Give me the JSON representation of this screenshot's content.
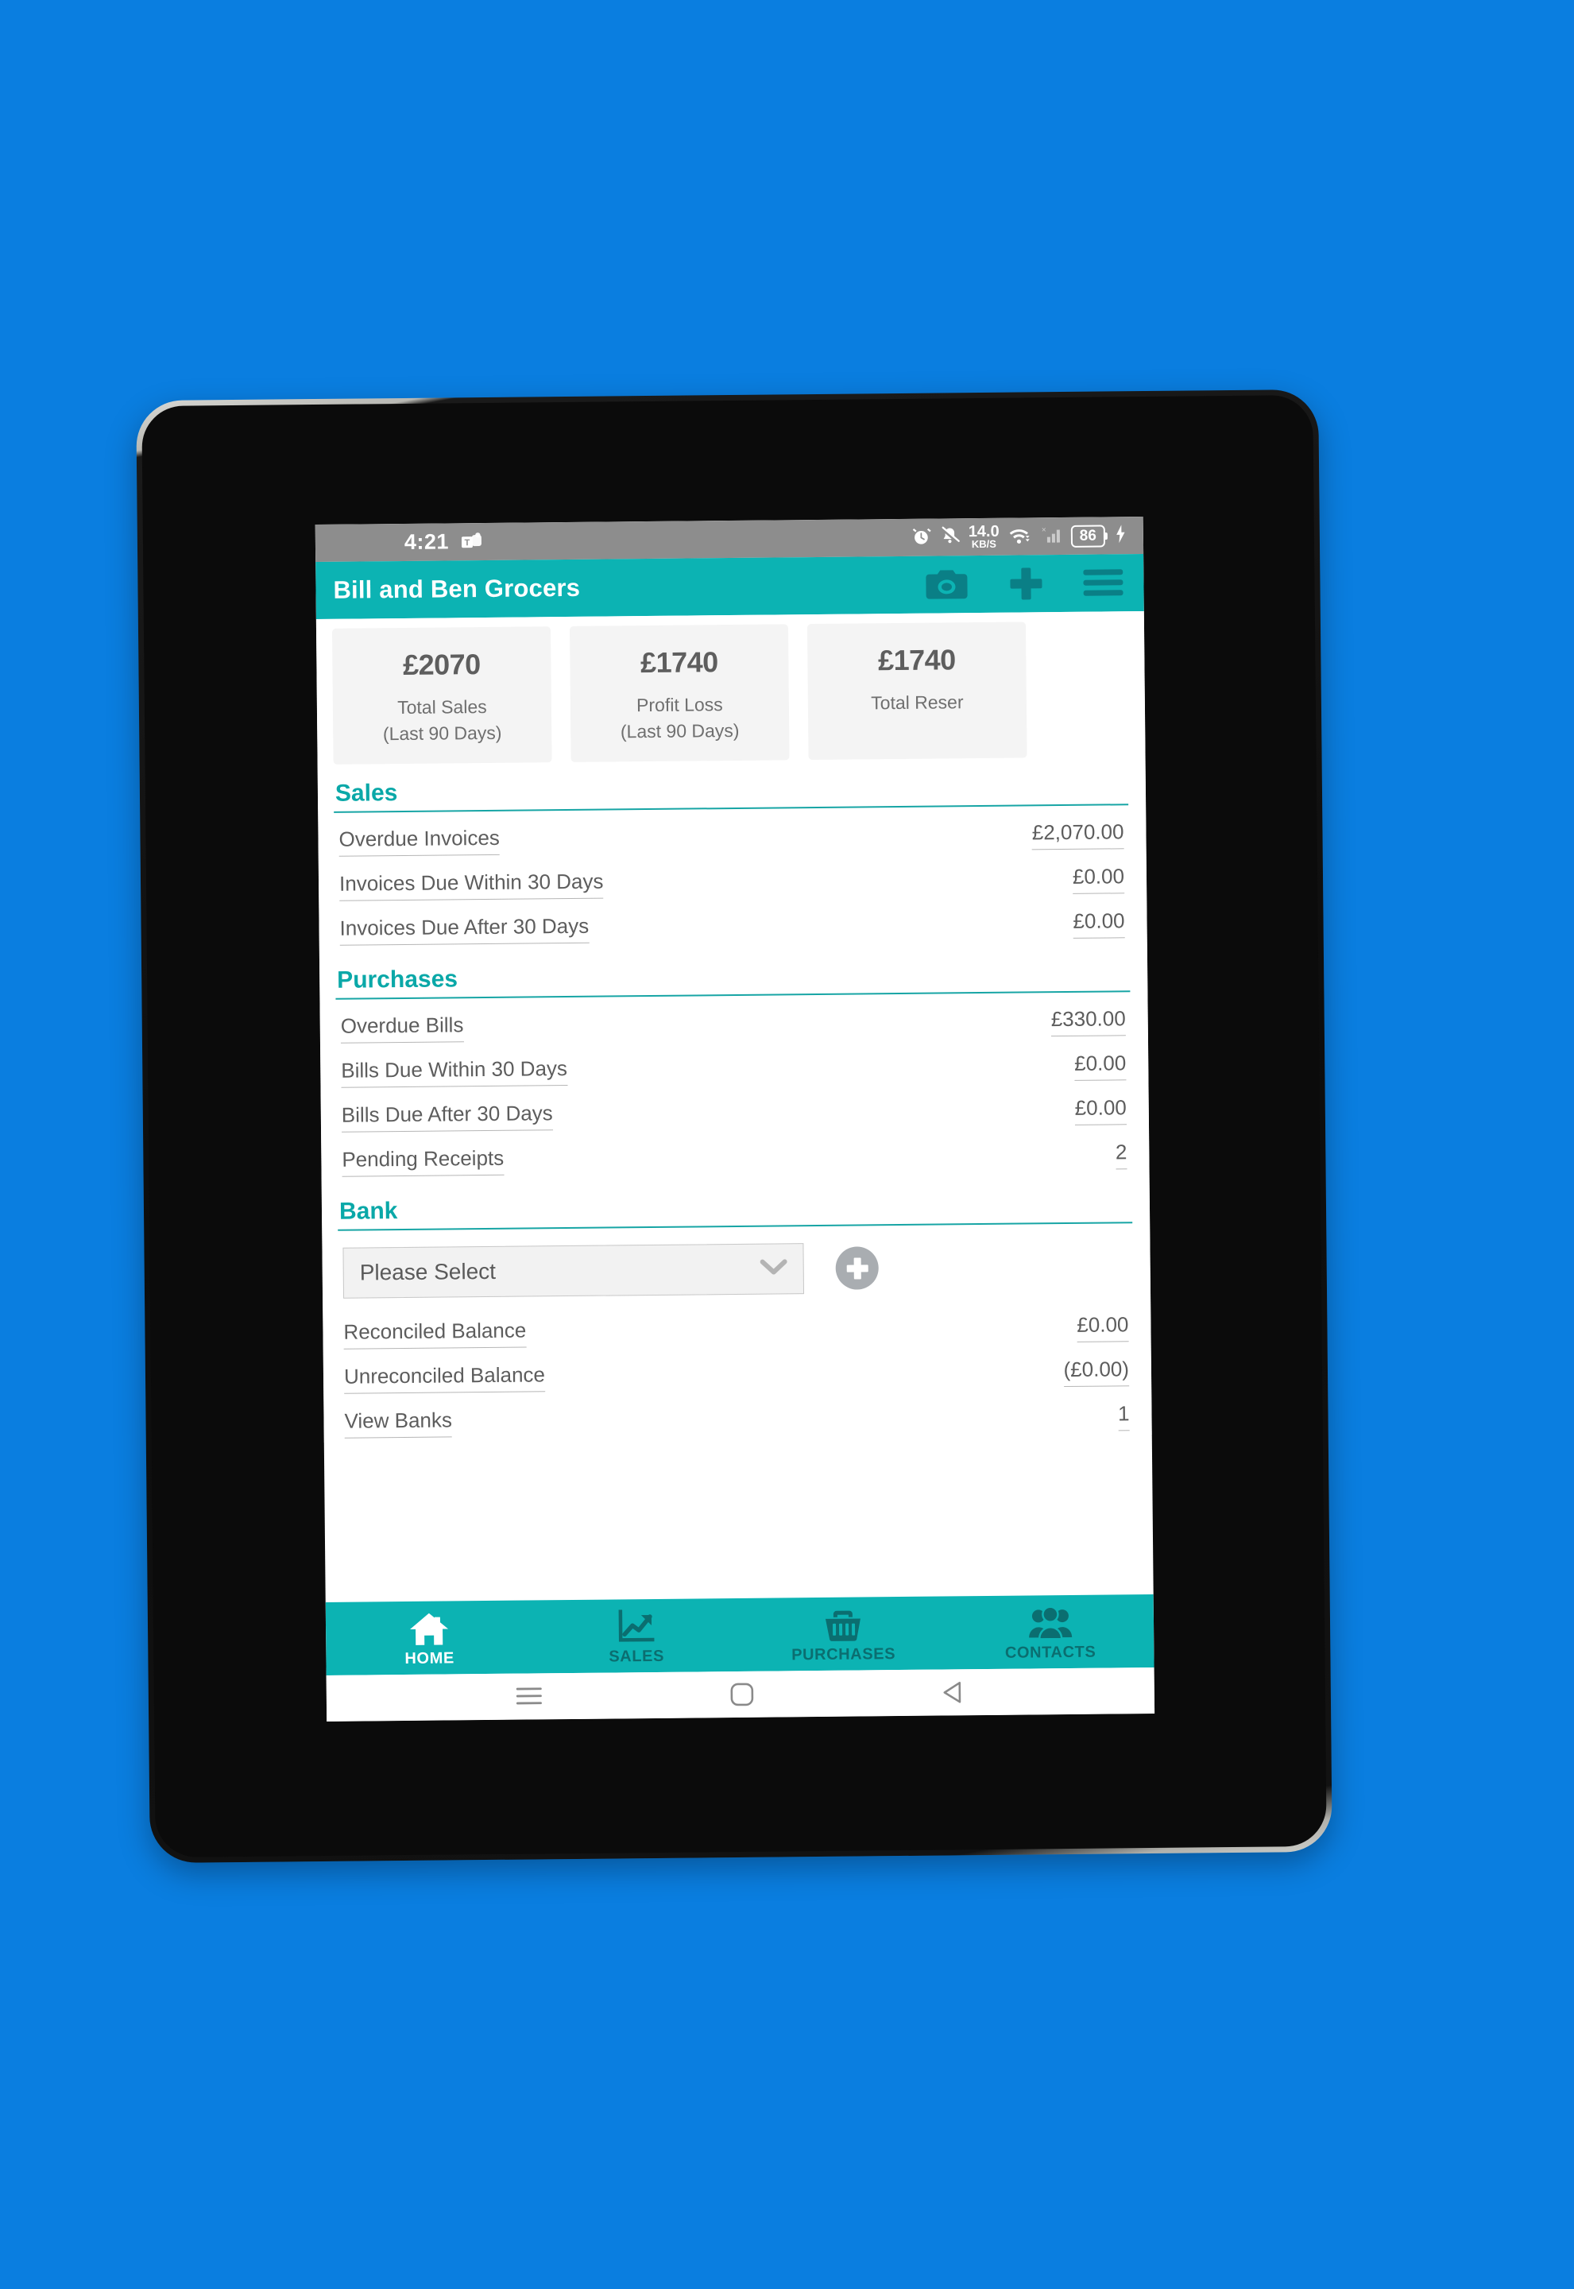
{
  "status_bar": {
    "time": "4:21",
    "teams_icon": "microsoft-teams-icon",
    "alarm_icon": "alarm-clock-icon",
    "mute_icon": "bell-muted-icon",
    "net_speed_value": "14.0",
    "net_speed_unit": "KB/S",
    "wifi_icon": "wifi-icon",
    "signal_icon": "cellular-signal-no-sim-icon",
    "battery_level": "86",
    "charging_icon": "charging-bolt-icon"
  },
  "header": {
    "title": "Bill and Ben Grocers",
    "camera_label": "camera-icon",
    "add_label": "plus-icon",
    "menu_label": "hamburger-menu-icon"
  },
  "summary_cards": [
    {
      "value": "£2070",
      "label_line1": "Total  Sales",
      "label_line2": "(Last 90 Days)"
    },
    {
      "value": "£1740",
      "label_line1": "Profit Loss",
      "label_line2": "(Last 90 Days)"
    },
    {
      "value": "£1740",
      "label_line1": "Total Reser",
      "label_line2": ""
    }
  ],
  "sections": {
    "sales": {
      "title": "Sales",
      "rows": [
        {
          "label": "Overdue Invoices",
          "value": "£2,070.00"
        },
        {
          "label": "Invoices Due Within 30 Days",
          "value": "£0.00"
        },
        {
          "label": "Invoices Due After 30 Days",
          "value": "£0.00"
        }
      ]
    },
    "purchases": {
      "title": "Purchases",
      "rows": [
        {
          "label": "Overdue Bills",
          "value": "£330.00"
        },
        {
          "label": "Bills Due Within 30 Days",
          "value": "£0.00"
        },
        {
          "label": "Bills Due After 30 Days",
          "value": "£0.00"
        },
        {
          "label": "Pending Receipts",
          "value": "2"
        }
      ]
    },
    "bank": {
      "title": "Bank",
      "select_value": "Please Select",
      "add_button_label": "add-bank-icon",
      "rows": [
        {
          "label": "Reconciled Balance",
          "value": "£0.00"
        },
        {
          "label": "Unreconciled Balance",
          "value": "(£0.00)"
        },
        {
          "label": "View Banks",
          "value": "1"
        }
      ]
    }
  },
  "tab_bar": [
    {
      "label": "HOME",
      "icon": "home-icon",
      "active": true
    },
    {
      "label": "SALES",
      "icon": "line-chart-icon",
      "active": false
    },
    {
      "label": "PURCHASES",
      "icon": "shopping-basket-icon",
      "active": false
    },
    {
      "label": "CONTACTS",
      "icon": "people-group-icon",
      "active": false
    }
  ],
  "android_nav": {
    "recents_label": "recents-icon",
    "home_label": "home-square-icon",
    "back_label": "back-triangle-icon"
  },
  "colors": {
    "background_blue": "#0a7ee0",
    "teal_primary": "#0cb3b3",
    "teal_heading": "#0aa8a8",
    "tab_inactive": "#0b6e70",
    "status_bar_gray": "#8d8d8d"
  }
}
